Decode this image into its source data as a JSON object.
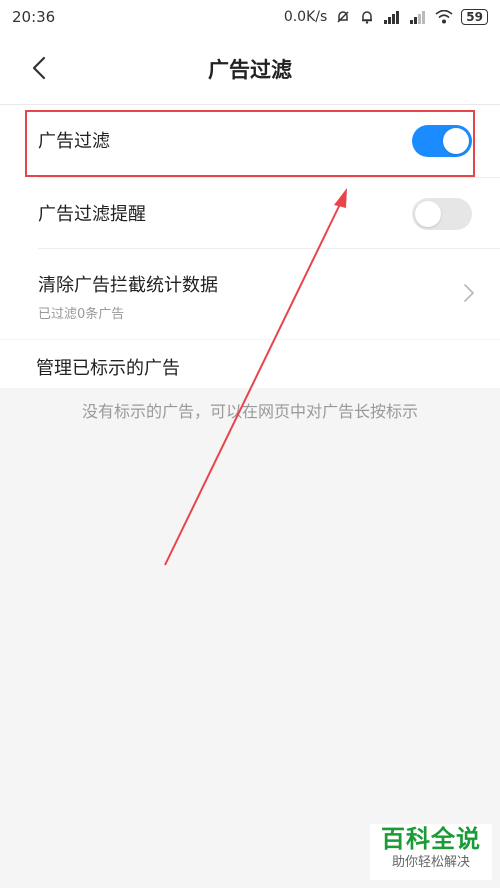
{
  "status_bar": {
    "time": "20:36",
    "speed": "0.0K/s",
    "battery": "59",
    "icons": [
      "mute-bell-icon",
      "alarm-icon",
      "signal-icon",
      "signal-icon",
      "wifi-icon",
      "battery-icon"
    ]
  },
  "header": {
    "title": "广告过滤",
    "back_icon": "chevron-left-icon"
  },
  "settings": {
    "ad_filter": {
      "label": "广告过滤",
      "enabled": true
    },
    "ad_filter_reminder": {
      "label": "广告过滤提醒",
      "enabled": false
    },
    "clear_stats": {
      "label": "清除广告拦截统计数据",
      "sub": "已过滤0条广告",
      "icon": "chevron-right-icon"
    }
  },
  "marked_ads": {
    "title": "管理已标示的广告",
    "empty_text": "没有标示的广告，可以在网页中对广告长按标示"
  },
  "annotation": {
    "color": "#e8454b"
  },
  "watermark": {
    "main": "百科全说",
    "sub": "助你轻松解决"
  },
  "colors": {
    "accent": "#1a8cff",
    "watermark_green": "#1a9b35"
  }
}
